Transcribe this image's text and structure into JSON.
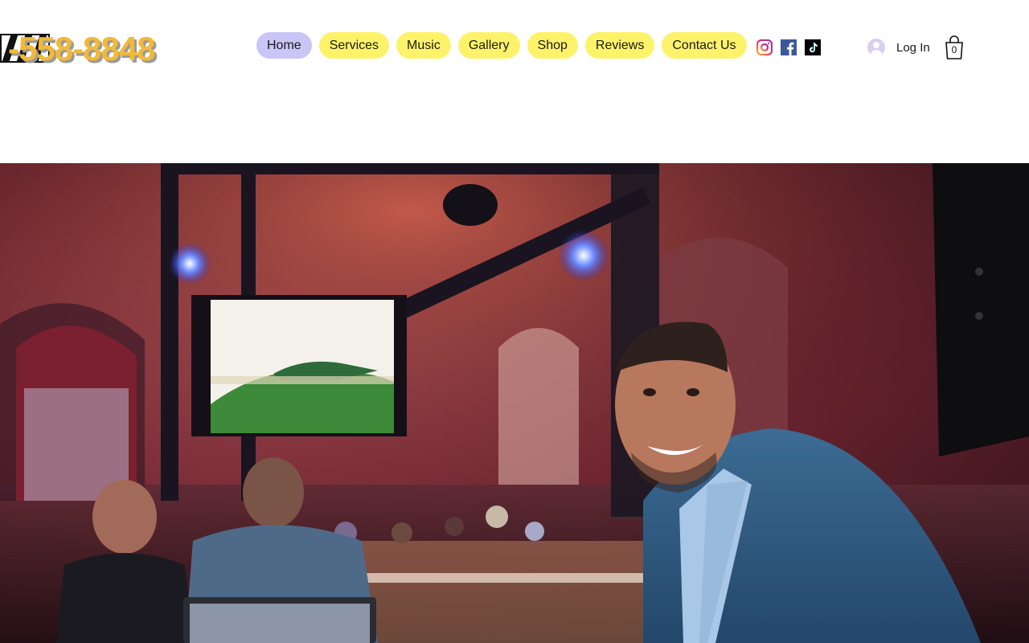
{
  "brand": {
    "phone": "-558-8848",
    "logo_icon": "dj-logo-badge"
  },
  "nav": {
    "items": [
      {
        "label": "Home",
        "active": true
      },
      {
        "label": "Services",
        "active": false
      },
      {
        "label": "Music",
        "active": false
      },
      {
        "label": "Gallery",
        "active": false
      },
      {
        "label": "Shop",
        "active": false
      },
      {
        "label": "Reviews",
        "active": false
      },
      {
        "label": "Contact Us",
        "active": false
      }
    ]
  },
  "social": [
    "instagram-icon",
    "facebook-icon",
    "tiktok-icon"
  ],
  "account": {
    "login_label": "Log In",
    "icon": "user-avatar-icon"
  },
  "cart": {
    "count": "0",
    "icon": "shopping-bag-icon"
  },
  "hero": {
    "image": "photo of smiling DJ in blue suit at event venue with stage lighting and screen"
  },
  "colors": {
    "nav_bg": "#fdf36b",
    "nav_active_bg": "#c9c6f5",
    "phone_text": "#f2b938"
  }
}
